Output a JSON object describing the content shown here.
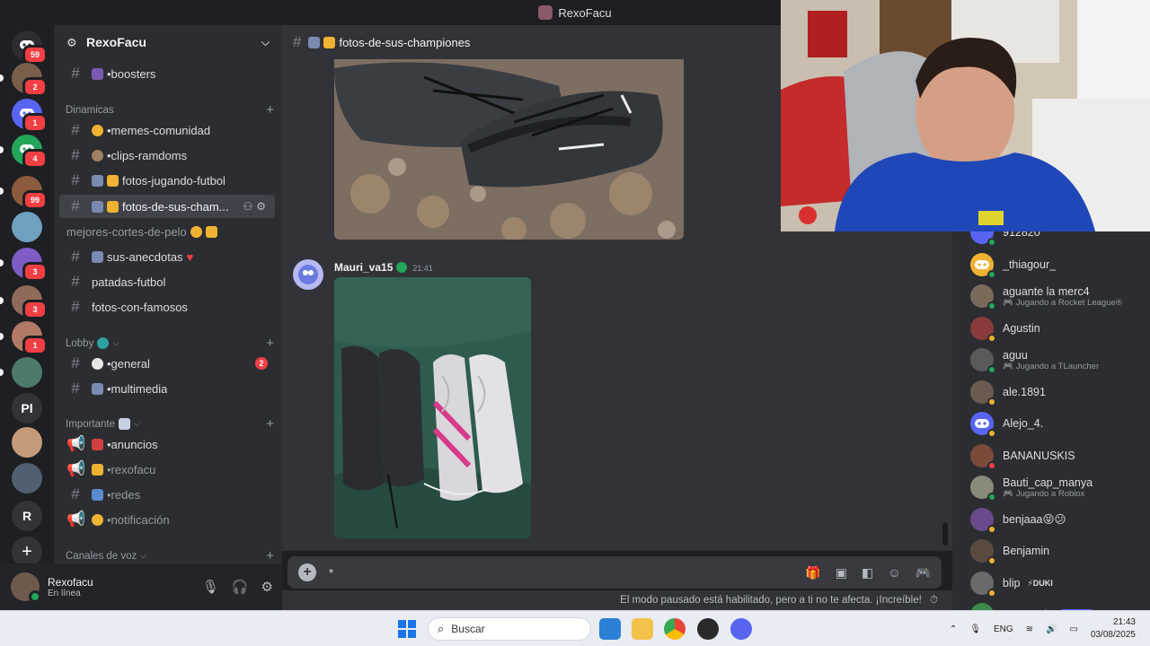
{
  "window": {
    "title": "RexoFacu"
  },
  "rail": {
    "servers": [
      {
        "name": "home",
        "badge": "59",
        "color": "#2b2d31",
        "glyph": "discord-icon"
      },
      {
        "name": "server-2",
        "badge": "2",
        "color": "#7a5e4c"
      },
      {
        "name": "server-3",
        "badge": "1",
        "color": "#5865f2",
        "glyph": "discord-icon"
      },
      {
        "name": "server-4",
        "badge": "4",
        "color": "#23a55a",
        "glyph": "discord-icon"
      },
      {
        "name": "server-5",
        "badge": "99",
        "color": "#8c5a3c"
      },
      {
        "name": "server-6",
        "badge": "",
        "color": "#6fa0c0"
      },
      {
        "name": "server-7",
        "badge": "3",
        "color": "#7d5cc4"
      },
      {
        "name": "server-8",
        "badge": "3",
        "color": "#8f6a5a"
      },
      {
        "name": "server-9",
        "badge": "1",
        "color": "#b07a64"
      },
      {
        "name": "server-10",
        "badge": "",
        "color": "#4d7a6a"
      },
      {
        "name": "server-pl",
        "label": "Pl",
        "badge": "",
        "color": "#313338"
      },
      {
        "name": "server-12",
        "badge": "",
        "color": "#c59a7a"
      },
      {
        "name": "server-13",
        "badge": "",
        "color": "#506070"
      },
      {
        "name": "server-r",
        "label": "R",
        "badge": "",
        "color": "#313338"
      },
      {
        "name": "add-server",
        "label": "+",
        "badge": "",
        "color": "#313338"
      }
    ]
  },
  "guild": {
    "name": "RexoFacu"
  },
  "channels": {
    "boosters": "•boosters",
    "cat_dinamicas": "Dinamicas",
    "memes": "•memes-comunidad",
    "clips": "•clips-ramdoms",
    "fotos_jugando": "fotos-jugando-futbol",
    "fotos_sus": "fotos-de-sus-cham...",
    "mejores_cortes": "mejores-cortes-de-pelo",
    "sus_anecdotas": "sus-anecdotas",
    "patadas": "patadas-futbol",
    "fotos_famosos": "fotos-con-famosos",
    "cat_lobby": "Lobby",
    "general": "•general",
    "general_mentions": "2",
    "multimedia": "•multimedia",
    "cat_importante": "Importante",
    "anuncios": "•anuncios",
    "rexofacu": "•rexofacu",
    "redes": "•redes",
    "notificacion": "•notificación",
    "cat_voz": "Canales de voz"
  },
  "user": {
    "name": "Rexofacu",
    "status": "En línea"
  },
  "chat": {
    "channel_title": "fotos-de-sus-championes",
    "message": {
      "author": "Mauri_va15",
      "time": "21:41"
    },
    "composer_text": "*",
    "pause_notice": "El modo pausado está habilitado, pero a ti no te afecta. ¡Increíble!"
  },
  "members": [
    {
      "name": "912820",
      "activity": "",
      "color": "#5865f2",
      "status": "#23a55a"
    },
    {
      "name": "_thiagour_",
      "activity": "",
      "color": "#f0b232",
      "status": "#23a55a",
      "glyph": "discord-icon"
    },
    {
      "name": "aguante la merc4",
      "activity": "Jugando a Rocket League®",
      "color": "#7a6a5a",
      "status": "#23a55a"
    },
    {
      "name": "Agustin",
      "activity": "",
      "color": "#8a3a3a",
      "status": "#f0b232"
    },
    {
      "name": "aguu",
      "activity": "Jugando a TLauncher",
      "color": "#5a5a5a",
      "status": "#23a55a"
    },
    {
      "name": "ale.1891",
      "activity": "",
      "color": "#6a5a50",
      "status": "#f0b232"
    },
    {
      "name": "Alejo_4.",
      "activity": "",
      "color": "#5865f2",
      "status": "#f0b232",
      "glyph": "discord-icon"
    },
    {
      "name": "BANANUSKIS",
      "activity": "",
      "color": "#7a4a3a",
      "status": "#f23f43"
    },
    {
      "name": "Bauti_cap_manya",
      "activity": "Jugando a Roblox",
      "color": "#8a8a7a",
      "status": "#23a55a"
    },
    {
      "name": "benjaaa😝😕",
      "activity": "",
      "color": "#6a4a8a",
      "status": "#f0b232"
    },
    {
      "name": "Benjamin",
      "activity": "",
      "color": "#5a4a40",
      "status": "#f0b232"
    },
    {
      "name": "blip",
      "tag": "⚡DUKI",
      "activity": "",
      "color": "#6a6a6a",
      "status": "#f0b232"
    },
    {
      "name": "CactusFire",
      "tag": "✓ APP",
      "activity": "",
      "color": "#3a8a4a",
      "status": "#23a55a"
    }
  ],
  "taskbar": {
    "search_placeholder": "Buscar",
    "lang": "ENG",
    "time": "21:43",
    "date": "03/08/2025"
  }
}
